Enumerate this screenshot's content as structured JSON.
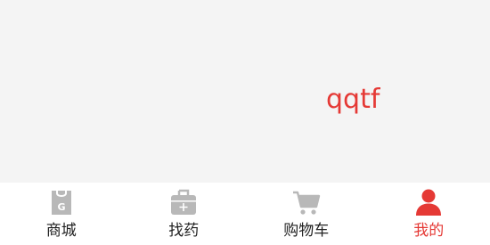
{
  "main": {
    "center_text": "qqtf"
  },
  "tabbar": {
    "tabs": [
      {
        "label": "商城",
        "icon": "shopping-bag-icon"
      },
      {
        "label": "找药",
        "icon": "medicine-kit-icon"
      },
      {
        "label": "购物车",
        "icon": "cart-icon"
      },
      {
        "label": "我的",
        "icon": "user-icon"
      }
    ],
    "active_index": 3
  },
  "colors": {
    "accent": "#e53935",
    "inactive_icon": "#b8b8b8",
    "content_bg": "#f4f4f4"
  }
}
